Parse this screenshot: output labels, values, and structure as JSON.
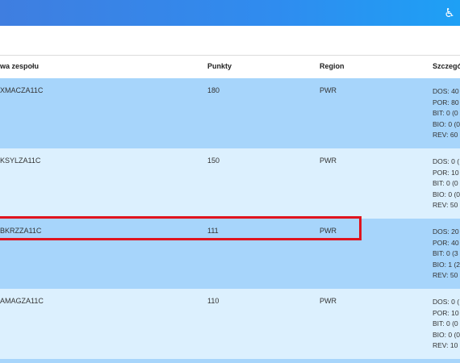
{
  "header": {
    "icon": "accessibility-icon"
  },
  "table": {
    "columns": {
      "name": "wa zespołu",
      "points": "Punkty",
      "region": "Region",
      "details": "Szczegó"
    },
    "rows": [
      {
        "name": "XMACZA11C",
        "points": "180",
        "region": "PWR",
        "details": [
          "DOS: 40",
          "POR: 80",
          "BIT: 0 (0",
          "BIO: 0 (0",
          "REV: 60"
        ]
      },
      {
        "name": "KSYLZA11C",
        "points": "150",
        "region": "PWR",
        "details": [
          "DOS: 0 (",
          "POR: 10",
          "BIT: 0 (0",
          "BIO: 0 (0",
          "REV: 50"
        ]
      },
      {
        "name": "BKRZZA11C",
        "points": "111",
        "region": "PWR",
        "details": [
          "DOS: 20",
          "POR: 40",
          "BIT: 0 (3",
          "BIO: 1 (2",
          "REV: 50"
        ]
      },
      {
        "name": "AMAGZA11C",
        "points": "110",
        "region": "PWR",
        "details": [
          "DOS: 0 (",
          "POR: 10",
          "BIT: 0 (0",
          "BIO: 0 (0",
          "REV: 10"
        ]
      }
    ]
  },
  "highlight_color": "#e0141e"
}
